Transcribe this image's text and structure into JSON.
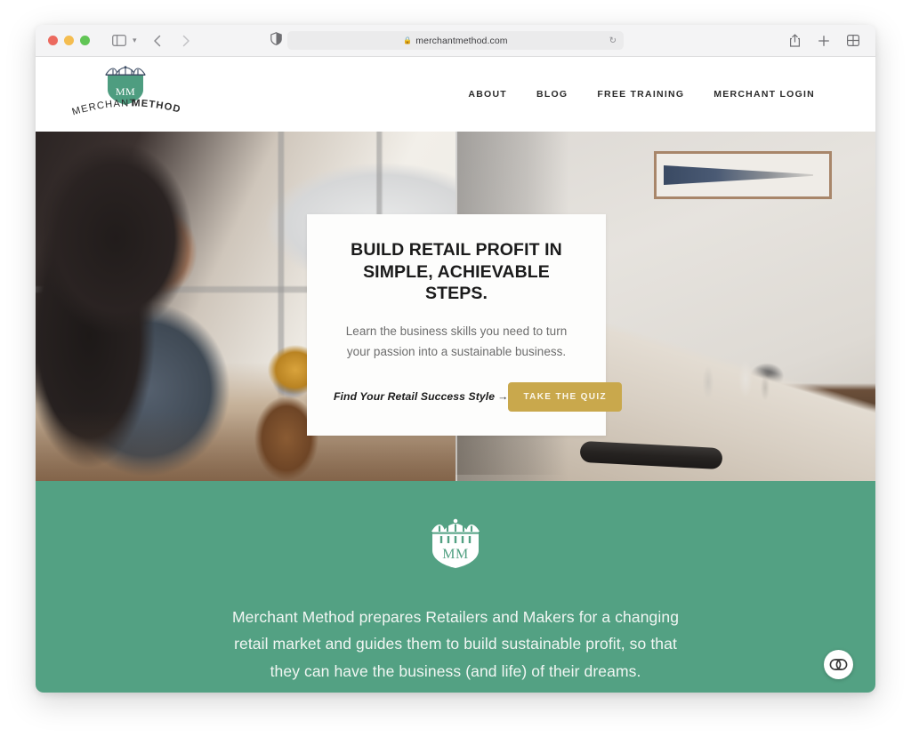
{
  "browser": {
    "traffic_lights": [
      "close",
      "minimize",
      "maximize"
    ],
    "sidebar_icon": "sidebar-icon",
    "dropdown_icon": "chevron-down-icon",
    "back_icon": "back-arrow-icon",
    "forward_icon": "forward-arrow-icon",
    "shield_icon": "privacy-shield-icon",
    "address": {
      "lock": "🔒",
      "url": "merchantmethod.com",
      "reload_icon": "reload-icon"
    },
    "share_icon": "share-icon",
    "new_tab_icon": "plus-icon",
    "tab_overview_icon": "tab-grid-icon"
  },
  "site": {
    "logo": {
      "wordmark": "MERCHANT METHOD",
      "monogram": "MM",
      "crest_icon": "merchant-method-crest-icon"
    },
    "nav": [
      {
        "label": "ABOUT"
      },
      {
        "label": "BLOG"
      },
      {
        "label": "FREE TRAINING"
      },
      {
        "label": "MERCHANT LOGIN"
      }
    ]
  },
  "hero": {
    "title_line1": "BUILD RETAIL PROFIT IN",
    "title_line2": "SIMPLE, ACHIEVABLE STEPS.",
    "subtitle_line1": "Learn the business skills you need to turn",
    "subtitle_line2": "your passion into a sustainable business.",
    "cta_text": "Find Your Retail Success Style",
    "cta_arrow": "→",
    "cta_button": "TAKE THE QUIZ",
    "images": {
      "left_alt": "woman working at desk near shop window",
      "right_alt": "retail shop interior with counter and framed art"
    }
  },
  "intro": {
    "crest_icon": "merchant-method-crest-icon",
    "monogram": "MM",
    "paragraph_line1": "Merchant Method prepares Retailers and Makers for a changing",
    "paragraph_line2": "retail market and guides them to build sustainable profit, so that",
    "paragraph_line3": "they can have the business (and life) of their dreams."
  },
  "accessibility_widget": {
    "icon": "accessibility-widget-icon",
    "label": "CO"
  },
  "colors": {
    "brand_green": "#53a183",
    "brand_gold": "#c9a84c",
    "logo_green": "#4e9d80",
    "logo_navy": "#3c4c63",
    "text_dark": "#1b1b1b"
  }
}
